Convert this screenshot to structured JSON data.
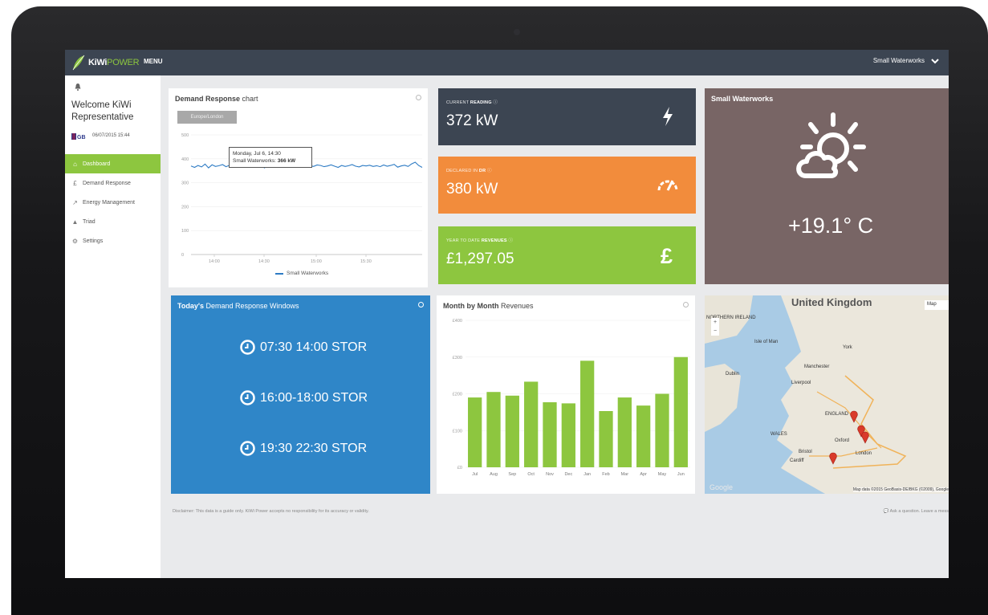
{
  "topbar": {
    "logo": "KiWi",
    "logo_power": "POWER",
    "menu_label": "MENU",
    "site_selector": "Small Waterworks"
  },
  "sidebar": {
    "welcome": "Welcome KiWi Representative",
    "date": "06/07/2015 15:44",
    "items": [
      {
        "label": "Dashboard",
        "icon": "home-icon",
        "active": true
      },
      {
        "label": "Demand Response",
        "icon": "pound-icon",
        "active": false
      },
      {
        "label": "Energy Management",
        "icon": "chart-line-icon",
        "active": false
      },
      {
        "label": "Triad",
        "icon": "warning-icon",
        "active": false
      },
      {
        "label": "Settings",
        "icon": "gear-icon",
        "active": false
      }
    ]
  },
  "dr_chart": {
    "title_bold": "Demand Response",
    "title_rest": " chart",
    "range_button": "Europe/London",
    "tooltip_line1": "Monday, Jul 6, 14:30",
    "tooltip_series": "Small Waterworks: ",
    "tooltip_value": "366 kW",
    "legend": "Small Waterworks"
  },
  "tiles": {
    "reading": {
      "label_pre": "CURRENT ",
      "label_bold": "READING",
      "value": "372 kW",
      "color": "#3c4552"
    },
    "declared": {
      "label_pre": "DECLARED IN ",
      "label_bold": "DR",
      "value": "380 kW",
      "color": "#f28c3c"
    },
    "revenue": {
      "label_pre": "YEAR TO DATE ",
      "label_bold": "REVENUES",
      "value": "£1,297.05",
      "color": "#8dc63f"
    }
  },
  "weather": {
    "title": "Small Waterworks",
    "temperature": "+19.1° C",
    "icon": "partly-cloudy-sun-icon"
  },
  "windows": {
    "title_bold": "Today's",
    "title_rest": " Demand Response Windows",
    "items": [
      "07:30 14:00  STOR",
      "16:00-18:00  STOR",
      "19:30 22:30  STOR"
    ]
  },
  "revenues": {
    "title_bold": "Month by Month",
    "title_rest": " Revenues"
  },
  "map": {
    "type_button": "Map",
    "country": "United Kingdom",
    "labels": [
      "NORTHERN IRELAND",
      "Isle of Man",
      "York",
      "Dublin",
      "Manchester",
      "Liverpool",
      "ENGLAND",
      "WALES",
      "Oxford",
      "London",
      "Bristol",
      "Cardiff"
    ],
    "google": "Google",
    "credit": "Map data ©2015 GeoBasis-DE/BKG (©2009), Google"
  },
  "footer": {
    "disclaimer": "Disclaimer: This data is a guide only. KiWi Power accepts no responsibility for its accuracy or validity.",
    "ask": "Ask a question. Leave a mess"
  },
  "chart_data": [
    {
      "type": "line",
      "title": "Demand Response chart",
      "x_ticks": [
        "14:00",
        "14:30",
        "15:00",
        "15:30"
      ],
      "y_ticks": [
        0,
        100,
        200,
        300,
        400,
        500
      ],
      "ylim": [
        0,
        500
      ],
      "legend": "bottom",
      "series": [
        {
          "name": "Small Waterworks",
          "color": "#2d7bc4",
          "values": [
            370,
            364,
            372,
            366,
            378,
            362,
            375,
            368,
            371,
            376,
            367,
            373,
            366,
            374,
            369,
            377,
            365,
            372,
            368,
            375,
            370,
            362,
            374,
            369,
            366,
            372,
            378,
            364,
            370,
            367,
            373,
            369,
            376,
            366,
            371,
            368,
            374,
            372,
            367,
            370,
            375,
            369,
            364,
            372,
            368,
            371,
            376,
            369,
            366,
            372,
            370,
            373,
            368,
            371,
            367,
            374,
            369,
            372,
            377,
            365,
            370,
            373,
            368,
            379,
            386,
            372,
            364
          ]
        }
      ]
    },
    {
      "type": "bar",
      "title": "Month by Month Revenues",
      "categories": [
        "Jul",
        "Aug",
        "Sep",
        "Oct",
        "Nov",
        "Dec",
        "Jan",
        "Feb",
        "Mar",
        "Apr",
        "May",
        "Jun"
      ],
      "y_ticks": [
        "£0",
        "£100",
        "£200",
        "£300",
        "£400"
      ],
      "ylim": [
        0,
        400
      ],
      "color": "#8dc63f",
      "values": [
        190,
        205,
        195,
        233,
        177,
        174,
        290,
        153,
        190,
        168,
        200,
        300
      ]
    }
  ]
}
